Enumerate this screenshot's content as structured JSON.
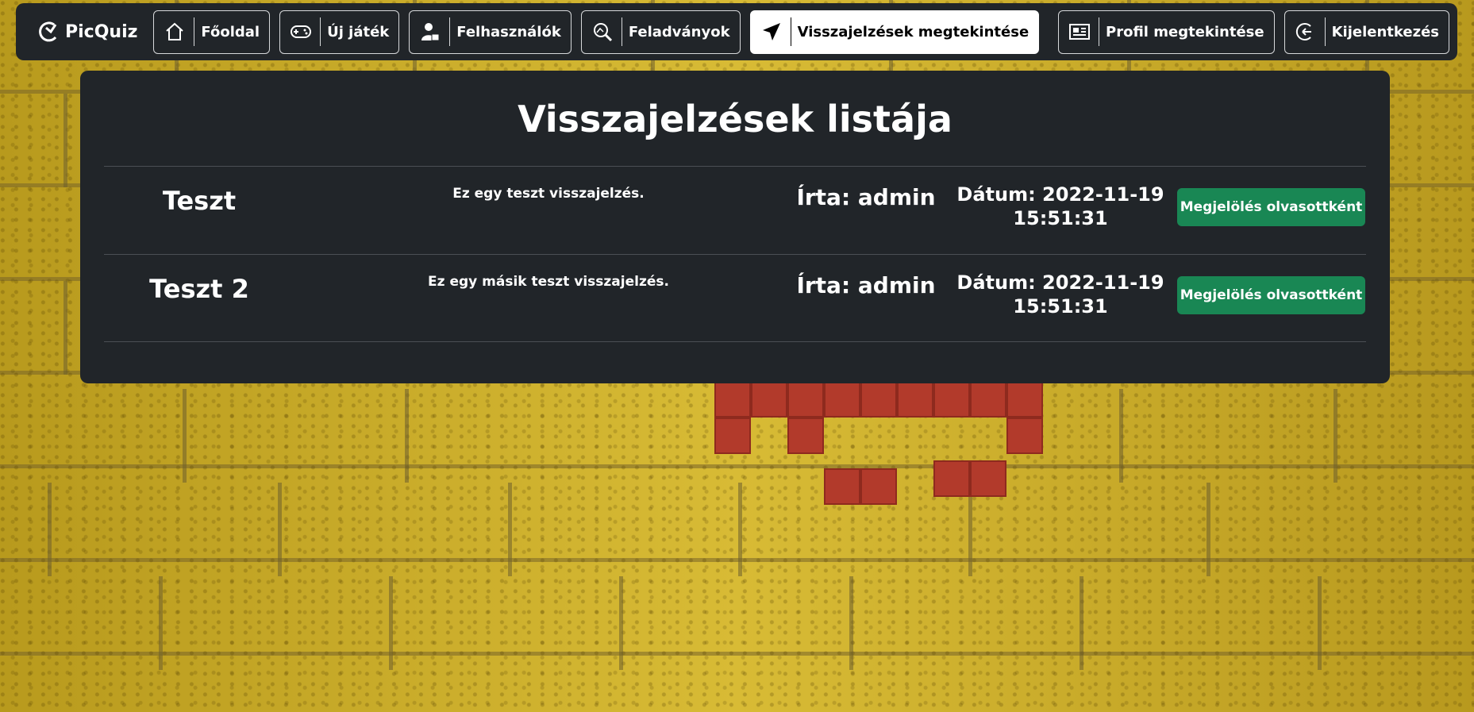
{
  "colors": {
    "navbar_bg": "#212529",
    "panel_bg": "#212529",
    "accent_green": "#198754",
    "active_nav_bg": "#ffffff"
  },
  "brand": {
    "name": "PicQuiz",
    "icon": "picquiz-logo-icon"
  },
  "nav": {
    "items": [
      {
        "label": "Főoldal",
        "icon": "home-icon"
      },
      {
        "label": "Új játék",
        "icon": "gamepad-icon"
      },
      {
        "label": "Felhasználók",
        "icon": "user-icon"
      },
      {
        "label": "Feladványok",
        "icon": "search-image-icon"
      },
      {
        "label": "Visszajelzések megtekintése",
        "icon": "send-icon",
        "active": true
      }
    ],
    "right": [
      {
        "label": "Profil megtekintése",
        "icon": "profile-card-icon"
      },
      {
        "label": "Kijelentkezés",
        "icon": "logout-icon"
      }
    ]
  },
  "page": {
    "title": "Visszajelzések listája"
  },
  "feedback": [
    {
      "title": "Teszt",
      "message": "Ez egy teszt visszajelzés.",
      "author": "Írta: admin",
      "date_line1": "Dátum: 2022-11-19",
      "date_line2": "15:51:31",
      "action": "Megjelölés olvasottként"
    },
    {
      "title": "Teszt 2",
      "message": "Ez egy másik teszt visszajelzés.",
      "author": "Írta: admin",
      "date_line1": "Dátum: 2022-11-19",
      "date_line2": "15:51:31",
      "action": "Megjelölés olvasottként"
    }
  ]
}
